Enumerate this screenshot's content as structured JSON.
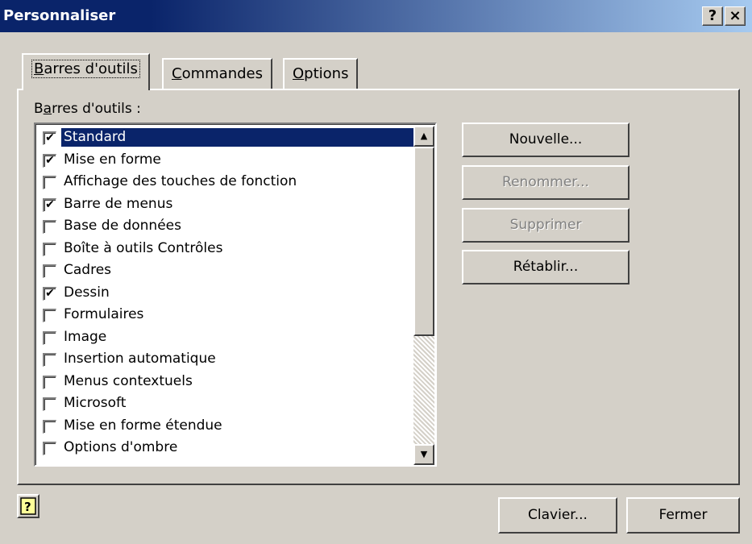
{
  "window": {
    "title": "Personnaliser"
  },
  "title_buttons": {
    "help": "?",
    "close": "×"
  },
  "tabs": [
    {
      "label": "Barres d'outils",
      "mnemonic": "B",
      "active": true
    },
    {
      "label": "Commandes",
      "mnemonic": "C",
      "active": false
    },
    {
      "label": "Options",
      "mnemonic": "O",
      "active": false
    }
  ],
  "toolbars_label": "Barres d'outils :",
  "toolbars": [
    {
      "label": "Standard",
      "checked": true,
      "selected": true
    },
    {
      "label": "Mise en forme",
      "checked": true
    },
    {
      "label": "Affichage des touches de fonction",
      "checked": false
    },
    {
      "label": "Barre de menus",
      "checked": true
    },
    {
      "label": "Base de données",
      "checked": false
    },
    {
      "label": "Boîte à outils Contrôles",
      "checked": false
    },
    {
      "label": "Cadres",
      "checked": false
    },
    {
      "label": "Dessin",
      "checked": true
    },
    {
      "label": "Formulaires",
      "checked": false
    },
    {
      "label": "Image",
      "checked": false
    },
    {
      "label": "Insertion automatique",
      "checked": false
    },
    {
      "label": "Menus contextuels",
      "checked": false
    },
    {
      "label": "Microsoft",
      "checked": false
    },
    {
      "label": "Mise en forme étendue",
      "checked": false
    },
    {
      "label": "Options d'ombre",
      "checked": false
    }
  ],
  "actions": {
    "new": "Nouvelle...",
    "rename": "Renommer...",
    "delete": "Supprimer",
    "reset": "Rétablir..."
  },
  "footer": {
    "keyboard": "Clavier...",
    "close": "Fermer"
  },
  "icons": {
    "check": "✔",
    "scroll_up": "▲",
    "scroll_down": "▼"
  },
  "colors": {
    "title_start": "#0a246a",
    "title_end": "#a6caf0",
    "face": "#d4d0c8",
    "selection": "#0a246a"
  }
}
